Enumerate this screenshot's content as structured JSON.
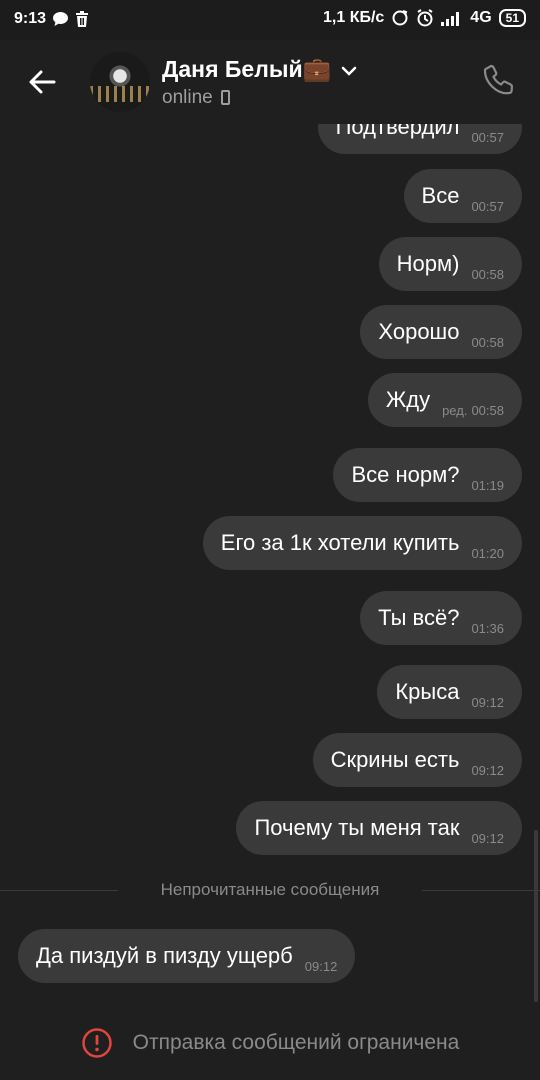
{
  "status_bar": {
    "time": "9:13",
    "network_speed": "1,1 КБ/с",
    "network_type": "4G",
    "battery": "51"
  },
  "header": {
    "contact_name": "Даня Белый",
    "contact_emoji": "💼",
    "status": "online",
    "icons": [
      "back-arrow-icon",
      "chevron-down-icon",
      "phone-call-icon",
      "mobile-device-icon"
    ]
  },
  "messages": [
    {
      "text": "Подтвердил",
      "time": "00:57",
      "edited": "",
      "direction": "out"
    },
    {
      "text": "Все",
      "time": "00:57",
      "edited": "",
      "direction": "out"
    },
    {
      "text": "Норм)",
      "time": "00:58",
      "edited": "",
      "direction": "out"
    },
    {
      "text": "Хорошо",
      "time": "00:58",
      "edited": "",
      "direction": "out"
    },
    {
      "text": "Жду",
      "time": "00:58",
      "edited": "ред.",
      "direction": "out"
    },
    {
      "text": "Все норм?",
      "time": "01:19",
      "edited": "",
      "direction": "out"
    },
    {
      "text": "Его за 1к хотели купить",
      "time": "01:20",
      "edited": "",
      "direction": "out"
    },
    {
      "text": "Ты всё?",
      "time": "01:36",
      "edited": "",
      "direction": "out"
    },
    {
      "text": "Крыса",
      "time": "09:12",
      "edited": "",
      "direction": "out"
    },
    {
      "text": "Скрины есть",
      "time": "09:12",
      "edited": "",
      "direction": "out"
    },
    {
      "text": "Почему ты меня так",
      "time": "09:12",
      "edited": "",
      "direction": "out"
    },
    {
      "text": "Да пиздуй в пизду ущерб",
      "time": "09:12",
      "edited": "",
      "direction": "in"
    }
  ],
  "unread_divider": "Непрочитанные сообщения",
  "restricted_notice": "Отправка сообщений ограничена",
  "colors": {
    "background": "#1f1f1f",
    "bubble": "#3a3a3a",
    "muted_text": "#8a8a8a",
    "warning": "#e0453f"
  }
}
